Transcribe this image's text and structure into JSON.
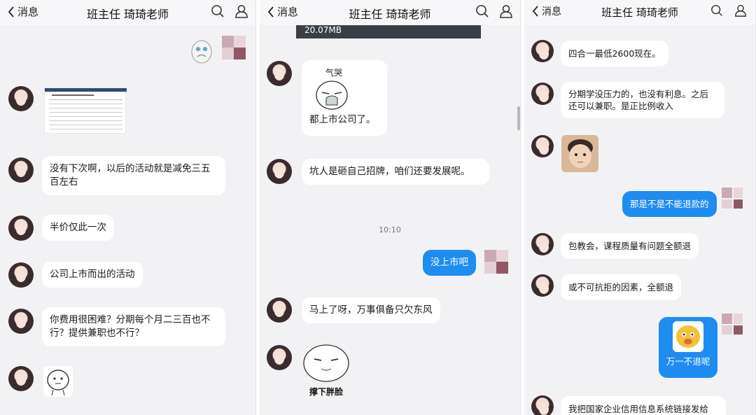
{
  "header": {
    "back_label": "消息",
    "title": "班主任 琦琦老师"
  },
  "panel1": {
    "messages": [
      "没有下次啊，以后的活动就是减免三五百左右",
      "半价仅此一次",
      "公司上市而出的活动",
      "你费用很困难？分期每个月二三百也不行？提供兼职也不行？"
    ]
  },
  "panel2": {
    "video_size": "20.07MB",
    "sticker_caption_top": "气哭",
    "msg_listed": "都上市公司了。",
    "msg_pit": "坑人是砸自己招牌，咱们还要发展呢。",
    "timestamp": "10:10",
    "me_not_listed": "没上市吧",
    "msg_soon": "马上了呀，万事俱备只欠东风",
    "sticker_caption_bottom": "撑下胖脸"
  },
  "panel3": {
    "msg_price": "四合一最低2600现在。",
    "msg_installment": "分期学没压力的，也没有利息。之后还可以兼职。是正比例收入",
    "me_refund": "那是不是不能退款的",
    "msg_guarantee": "包教会，课程质量有问题全额退",
    "msg_force": "或不可抗拒的因素，全额退",
    "me_in_case": "万一不退呢",
    "msg_link": "我把国家企业信用信息系统链接发给"
  },
  "colors": {
    "bubble_me": "#1e8cf0",
    "bubble_other": "#ffffff",
    "background": "#f2f2f5"
  },
  "icons": [
    "chevron-left-icon",
    "search-icon",
    "user-icon"
  ]
}
